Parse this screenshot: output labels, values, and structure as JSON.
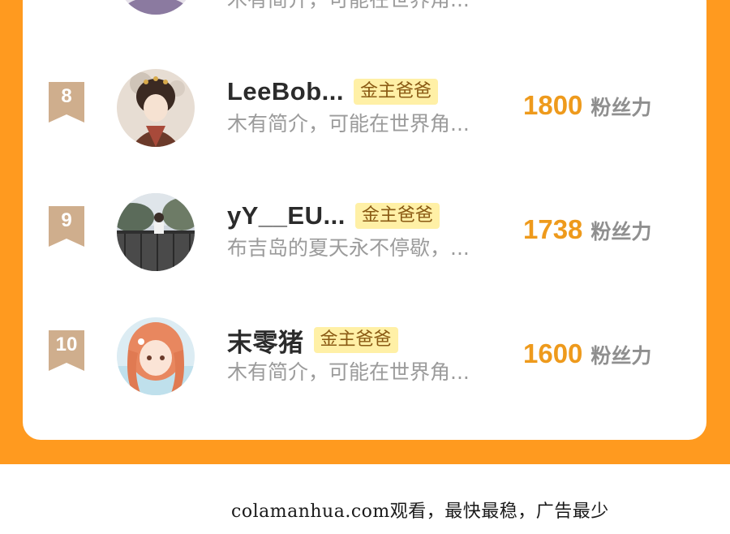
{
  "leaderboard": {
    "previous_entry": {
      "bio": "木有简介，可能在世界角..."
    },
    "entries": [
      {
        "rank": "8",
        "username": "LeeBob...",
        "badge": "金主爸爸",
        "bio": "木有简介，可能在世界角...",
        "fans_count": "1800",
        "fans_unit": "粉丝力"
      },
      {
        "rank": "9",
        "username": "yY__EU...",
        "badge": "金主爸爸",
        "bio": "布吉岛的夏天永不停歇，...",
        "fans_count": "1738",
        "fans_unit": "粉丝力"
      },
      {
        "rank": "10",
        "username": "末零猪",
        "badge": "金主爸爸",
        "bio": "木有简介，可能在世界角...",
        "fans_count": "1600",
        "fans_unit": "粉丝力"
      }
    ]
  },
  "watermark": "colamanhua.com观看，最快最稳，广告最少",
  "colors": {
    "orange_band": "#ff9a1f",
    "rank_ribbon": "#cfae8d",
    "fans_count": "#ee9a1c",
    "badge_bg": "#fff0a6",
    "badge_text": "#8a5a14"
  },
  "icons": {
    "rank": "ribbon-bookmark-icon",
    "avatar": "user-avatar-image"
  }
}
